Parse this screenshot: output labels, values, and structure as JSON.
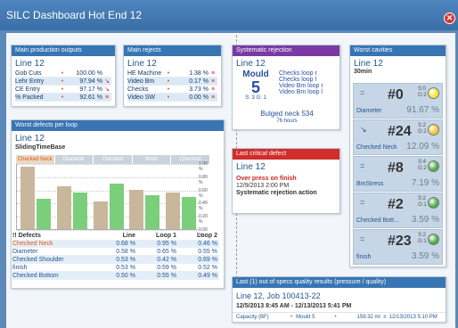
{
  "window": {
    "title": "SILC Dashboard Hot End 12"
  },
  "colors": {
    "header": "#3875b3",
    "purple": "#7b3aa3",
    "red": "#d12d2a",
    "accent_orange": "#e05a15"
  },
  "production": {
    "title": "Main production outputs",
    "line": "Line 12",
    "rows": [
      {
        "label": "Gob Cuts",
        "value": "100.00 %",
        "mark": ""
      },
      {
        "label": "Lehr Entry",
        "value": "97.94 %",
        "mark": "↘"
      },
      {
        "label": "CE Entry",
        "value": "97.17 %",
        "mark": "↘"
      },
      {
        "label": "% Packed",
        "value": "92.61 %",
        "mark": "≡"
      }
    ]
  },
  "rejects": {
    "title": "Main rejects",
    "line": "Line 12",
    "rows": [
      {
        "label": "HE Machine",
        "value": "1.38 %",
        "mark": "≡"
      },
      {
        "label": "Video Bm",
        "value": "0.17 %",
        "mark": "≡"
      },
      {
        "label": "Checks",
        "value": "3.73 %",
        "mark": "≡"
      },
      {
        "label": "Video SW",
        "value": "0.00 %",
        "mark": "≡"
      }
    ]
  },
  "systematic": {
    "title": "Systematic rejection",
    "line": "Line 12",
    "mould_label": "Mould",
    "mould_number": "5",
    "mould_sub": "S: 3 G: 1",
    "checks": [
      "Checks loop r",
      "Checks loop l",
      "Video Bm loop r",
      "Video Bm loop l"
    ],
    "defect": "Bulged neck 534",
    "hours": "76 hours"
  },
  "critical": {
    "title": "Last critical defect",
    "line": "Line 12",
    "defect": "Over press on finish",
    "time": "12/9/2013 2:00 PM",
    "action": "Systematic rejection action"
  },
  "worst_defects": {
    "title": "Worst defects per loop",
    "line": "Line 12",
    "subtitle": "SlidingTimeBase",
    "table_headers": [
      "!! Defects",
      "Line",
      "Loop 1",
      "Loop 2"
    ],
    "rows": [
      {
        "name": "Checked Neck",
        "line": "0.68 %",
        "loop1": "0.95 %",
        "loop2": "0.46 %"
      },
      {
        "name": "Diameter",
        "line": "0.58 %",
        "loop1": "0.65 %",
        "loop2": "0.55 %"
      },
      {
        "name": "Checked Shoulder",
        "line": "0.53 %",
        "loop1": "0.42 %",
        "loop2": "0.69 %"
      },
      {
        "name": "finish",
        "line": "0.53 %",
        "loop1": "0.59 %",
        "loop2": "0.52 %"
      },
      {
        "name": "Checked Bottom",
        "line": "0.50 %",
        "loop1": "0.55 %",
        "loop2": "0.49 %"
      }
    ]
  },
  "chart_data": {
    "type": "bar",
    "categories": [
      "Checked Neck",
      "Diameter",
      "Checked Shoulder",
      "finish",
      "Checked Bottom"
    ],
    "series": [
      {
        "name": "Loop 1",
        "values": [
          0.95,
          0.65,
          0.42,
          0.59,
          0.55
        ]
      },
      {
        "name": "Loop 2",
        "values": [
          0.46,
          0.55,
          0.69,
          0.52,
          0.49
        ]
      }
    ],
    "yticks": [
      "1.00 %",
      "0.80 %",
      "0.60 %",
      "0.40 %",
      "0.20 %",
      "0.00 %"
    ],
    "ylim": [
      0,
      1.0
    ]
  },
  "cavities": {
    "title": "Worst cavities",
    "line": "Line 12",
    "period": "30min",
    "items": [
      {
        "num": "#0",
        "s": "S:0",
        "g": "G:2",
        "name": "Diameter",
        "pct": "91.67 %",
        "color": "#f2e640",
        "trend": "="
      },
      {
        "num": "#24",
        "s": "S:2",
        "g": "G:2",
        "name": "Checked Neck",
        "pct": "12.09 %",
        "color": "#f5c43c",
        "trend": "↘"
      },
      {
        "num": "#8",
        "s": "S:4",
        "g": "G:2",
        "name": "BmStress",
        "pct": "7.19 %",
        "color": "#4fb04a",
        "trend": "="
      },
      {
        "num": "#2",
        "s": "S:2",
        "g": "G:1",
        "name": "Checked Bott...",
        "pct": "3.59 %",
        "color": "#4fb04a",
        "trend": "="
      },
      {
        "num": "#23",
        "s": "S:2",
        "g": "G:1",
        "name": "finish",
        "pct": "3.59 %",
        "color": "#4fb04a",
        "trend": "="
      }
    ]
  },
  "oos": {
    "title": "Last (1) out of specs quality results (pressure / quality)",
    "line_job": "Line 12, Job 100413-22",
    "range": "12/5/2013 8:45 AM - 12/13/2013 5:41 PM",
    "row": {
      "label": "Capacity (BF)",
      "mould": "Mould 5",
      "value": "159.32 ml",
      "time": "12/13/2013 5:10 PM"
    }
  }
}
